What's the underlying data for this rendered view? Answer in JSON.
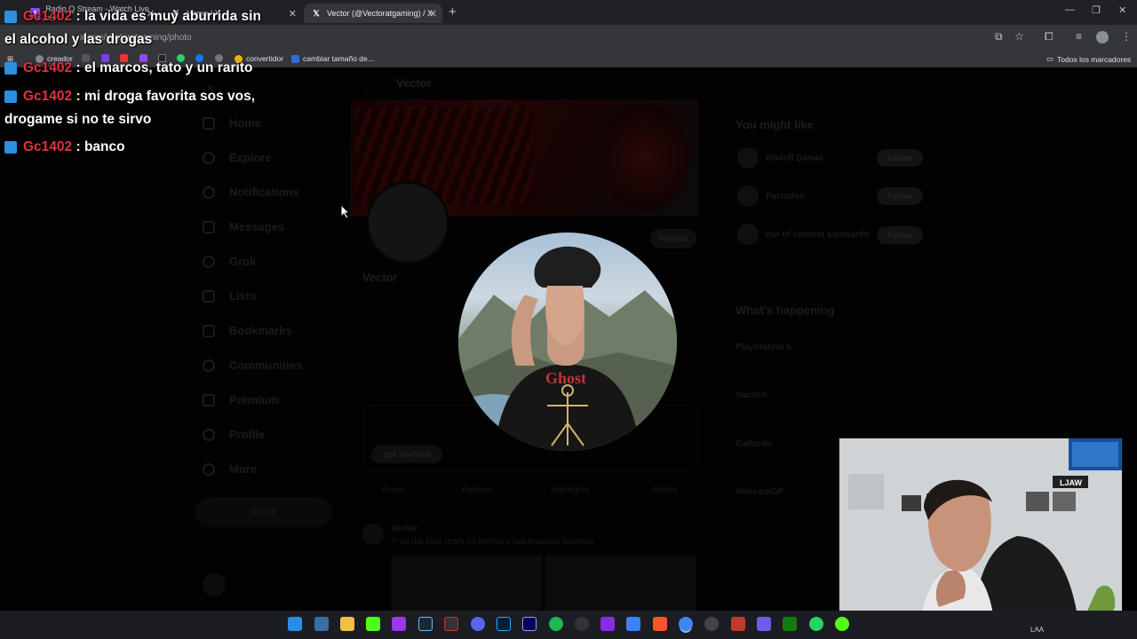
{
  "browser": {
    "tabs": [
      {
        "label": "Radio Q Stream - Watch Live on",
        "active": false
      },
      {
        "label": "Home / X",
        "active": false
      },
      {
        "label": "Vector (@Vectoratgaming) / X",
        "active": true
      }
    ],
    "url": "x.com/vectoratgaming/photo",
    "bookmarks": [
      "creador",
      "convertidor",
      "cambiar tamaño de..."
    ],
    "bookmarks_folder": "Todos los marcadores"
  },
  "chat": [
    {
      "user": "Gc1402",
      "text": " : la vida es muy aburrida sin",
      "text2": "el alcohol y las drogas"
    },
    {
      "user": "Gc1402",
      "text": " : el marcos, tato y un rarito"
    },
    {
      "user": "Gc1402",
      "text": " : mi droga favorita sos vos,",
      "text2": "drogame si no te sirvo"
    },
    {
      "user": "Gc1402",
      "text": " : banco"
    }
  ],
  "x_page": {
    "header_name": "Vector",
    "nav": [
      "Home",
      "Explore",
      "Notifications",
      "Messages",
      "Grok",
      "Lists",
      "Bookmarks",
      "Communities",
      "Premium",
      "Profile",
      "More"
    ],
    "post_button": "Post",
    "profile_name": "Vector",
    "follow_button": "Follow",
    "verified_banner": "get verified",
    "profile_tabs": [
      "Posts",
      "Replies",
      "Highlights",
      "Media"
    ],
    "sidebar_title_1": "You might like",
    "suggestions": [
      "Rodolf Daniel",
      "Parrados",
      "out of context sanmartin"
    ],
    "follow_small": "Follow",
    "sidebar_title_2": "What's happening",
    "trends": [
      "PlayStation 5",
      "Sacrich",
      "Gallardo",
      "#MexicoGP"
    ],
    "tweet_author": "Vector",
    "tweet_text": "Y un dia hice team mi perrito y ladronapras tananas"
  },
  "taskbar": {
    "tray_text": "LAA"
  },
  "colors": {
    "chat_user": "#e4303f",
    "chrome_bg": "#202124",
    "taskbar_bg": "#1b1d22"
  }
}
